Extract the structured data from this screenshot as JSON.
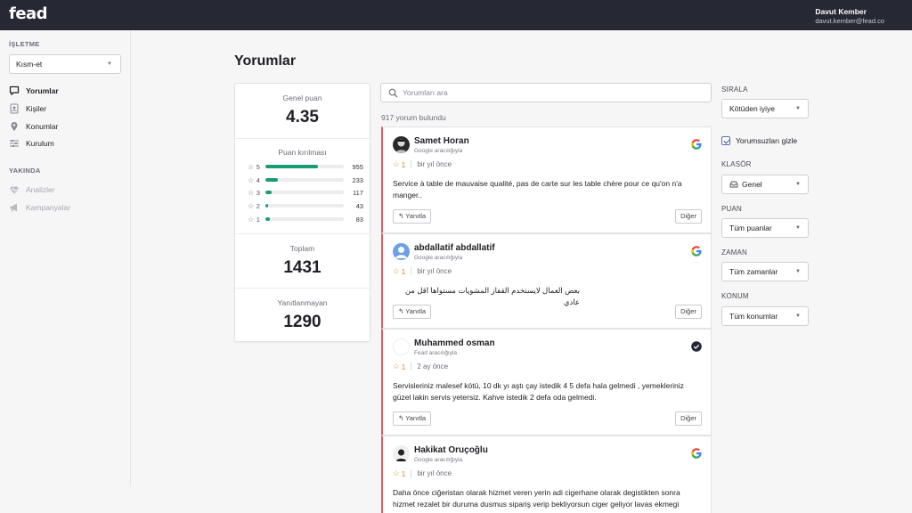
{
  "app": {
    "logo": "fead"
  },
  "user": {
    "name": "Davut Kember",
    "email": "davut.kember@fead.co"
  },
  "sidebar": {
    "business_heading": "İŞLETME",
    "business_select": "Kısm-et",
    "nav": [
      {
        "label": "Yorumlar",
        "icon": "comment-icon"
      },
      {
        "label": "Kişiler",
        "icon": "contact-card-icon"
      },
      {
        "label": "Konumlar",
        "icon": "location-pin-icon"
      },
      {
        "label": "Kurulum",
        "icon": "sliders-icon"
      }
    ],
    "soon_heading": "YAKINDA",
    "soon": [
      {
        "label": "Analizler",
        "icon": "heartbeat-icon"
      },
      {
        "label": "Kampanyalar",
        "icon": "megaphone-icon"
      }
    ]
  },
  "page": {
    "title": "Yorumlar"
  },
  "stats": {
    "overall_label": "Genel puan",
    "overall_value": "4.35",
    "breakdown_label": "Puan kırılması",
    "breakdown": [
      {
        "stars": "5",
        "count": "955",
        "fraction": 0.67
      },
      {
        "stars": "4",
        "count": "233",
        "fraction": 0.16
      },
      {
        "stars": "3",
        "count": "117",
        "fraction": 0.08
      },
      {
        "stars": "2",
        "count": "43",
        "fraction": 0.03
      },
      {
        "stars": "1",
        "count": "83",
        "fraction": 0.05
      }
    ],
    "total_label": "Toplam",
    "total_value": "1431",
    "unanswered_label": "Yanıtlanmayan",
    "unanswered_value": "1290"
  },
  "search": {
    "placeholder": "Yorumları ara"
  },
  "results": {
    "count_text": "917 yorum bulundu"
  },
  "reviews": [
    {
      "name": "Samet Horan",
      "source": "Google aracılığıyla",
      "rating": "1",
      "time": "bir yıl önce",
      "text": "Service à table de mauvaise qualité, pas de carte sur les table chère pour ce qu'on n'a manger..",
      "reply": "Yanıtla",
      "other": "Diğer",
      "logo": "google-icon"
    },
    {
      "name": "abdallatif abdallatif",
      "source": "Google aracılığıyla",
      "rating": "1",
      "time": "bir yıl önce",
      "text": "بعض العمال لايستخدم القفاز المشويات مستواها اقل من عادي",
      "reply": "Yanıtla",
      "other": "Diğer",
      "logo": "google-icon"
    },
    {
      "name": "Muhammed osman",
      "source": "Fead aracılığıyla",
      "rating": "1",
      "time": "2 ay önce",
      "text": "Servisleriniz malesef kötü, 10 dk yı aştı çay istedik 4 5 defa hala gelmedi , yemekleriniz güzel lakin servis yetersiz. Kahve istedik 2 defa oda gelmedi.",
      "reply": "Yanıtla",
      "other": "Diğer",
      "logo": "fead-icon"
    },
    {
      "name": "Hakikat Oruçoğlu",
      "source": "Google aracılığıyla",
      "rating": "1",
      "time": "bir yıl önce",
      "text": "Daha önce ciğeristan olarak hizmet veren yerin adi cigerhane olarak degistikten sonra hizmet rezalet bir duruma dusmus sipariş verip bekliyorsun ciger geliyor lavas ekmegi",
      "logo": "google-icon"
    }
  ],
  "filters": {
    "sort_label": "SIRALA",
    "sort_value": "Kötüden iyiye",
    "unanswered_checkbox": "Yorumsuzları gizle",
    "folder_label": "KLASÖR",
    "folder_value": "Genel",
    "rating_label": "PUAN",
    "rating_value": "Tüm puanlar",
    "time_label": "ZAMAN",
    "time_value": "Tüm zamanlar",
    "location_label": "KONUM",
    "location_value": "Tüm konumlar"
  },
  "colors": {
    "topbar": "#262834",
    "accent_green": "#1a9b73",
    "review_border": "#e05b61",
    "star": "#e08a1e"
  }
}
